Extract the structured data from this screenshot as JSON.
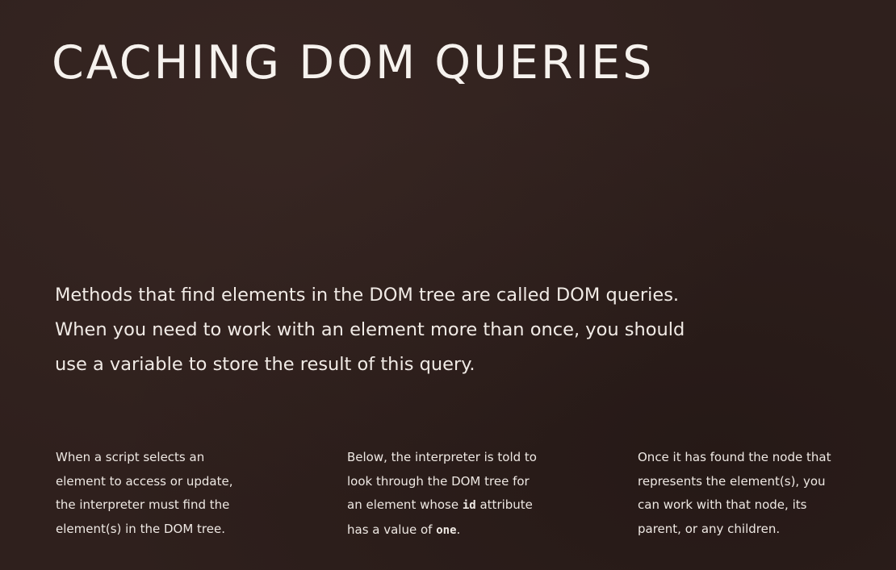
{
  "page": {
    "title": "CACHING DOM QUERIES",
    "intro_lines": [
      "Methods that find elements in the DOM tree are called DOM queries.",
      "When you need to work with an element more than once, you should",
      "use a variable to store the result of this query."
    ],
    "columns": [
      {
        "lines": [
          "When a script selects an",
          "element to access or update,",
          "the interpreter must find the",
          "element(s) in the DOM tree."
        ]
      },
      {
        "line1": "Below, the interpreter is told to",
        "line2": "look through the DOM tree for",
        "line3_before": "an element whose ",
        "line3_code": "id",
        "line3_after": " attribute",
        "line4_before": "has a value of ",
        "line4_code": "one",
        "line4_after": "."
      },
      {
        "lines": [
          "Once it has found the node that",
          "represents the element(s), you",
          "can work with that node, its",
          "parent, or any children."
        ]
      }
    ]
  }
}
